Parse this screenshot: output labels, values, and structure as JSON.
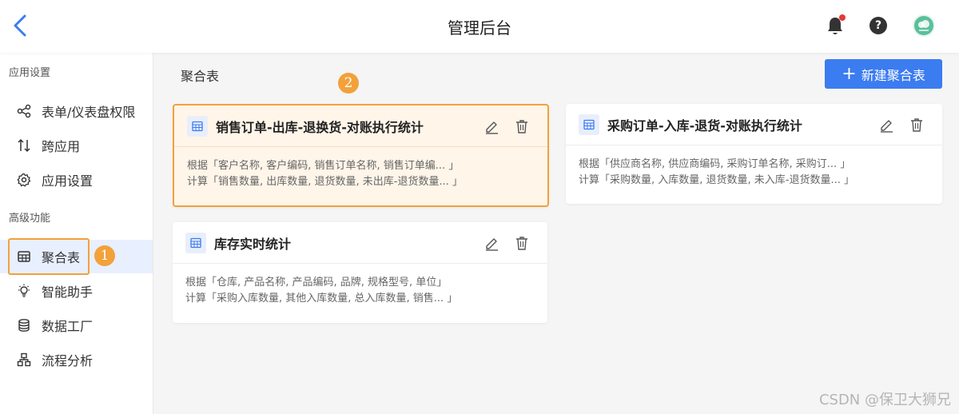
{
  "header": {
    "title": "管理后台",
    "icons": [
      "back-chevron-icon",
      "bell-icon",
      "help-icon",
      "avatar"
    ],
    "help_label": "?"
  },
  "sidebar": {
    "sections": [
      {
        "label": "应用设置",
        "items": [
          {
            "label": "表单/仪表盘权限",
            "icon": "share-icon"
          },
          {
            "label": "跨应用",
            "icon": "cross-app-icon"
          },
          {
            "label": "应用设置",
            "icon": "gear-icon"
          }
        ]
      },
      {
        "label": "高级功能",
        "items": [
          {
            "label": "聚合表",
            "icon": "table-icon",
            "active": true
          },
          {
            "label": "智能助手",
            "icon": "lightbulb-icon"
          },
          {
            "label": "数据工厂",
            "icon": "database-icon"
          },
          {
            "label": "流程分析",
            "icon": "flow-icon"
          }
        ]
      }
    ]
  },
  "main": {
    "breadcrumb": "聚合表",
    "new_button": "新建聚合表",
    "cards": [
      {
        "title": "销售订单-出库-退换货-对账执行统计",
        "basis": "根据「客户名称, 客户编码, 销售订单名称, 销售订单编... 」",
        "calc": "计算「销售数量, 出库数量, 退货数量, 未出库-退货数量... 」"
      },
      {
        "title": "采购订单-入库-退货-对账执行统计",
        "basis": "根据「供应商名称, 供应商编码, 采购订单名称, 采购订... 」",
        "calc": "计算「采购数量, 入库数量, 退货数量, 未入库-退货数量... 」"
      },
      {
        "title": "库存实时统计",
        "basis": "根据「仓库, 产品名称, 产品编码, 品牌, 规格型号, 单位」",
        "calc": "计算「采购入库数量, 其他入库数量, 总入库数量, 销售... 」"
      }
    ]
  },
  "annotations": {
    "badge1": "1",
    "badge2": "2",
    "accent_color": "#f2a13b"
  },
  "watermark": "CSDN @保卫大狮兄",
  "colors": {
    "primary": "#3b7cf0",
    "active_bg": "#e8efff",
    "highlight_border": "#f2a13b",
    "highlight_bg": "#fff5e9",
    "notification_dot": "#e53935"
  }
}
